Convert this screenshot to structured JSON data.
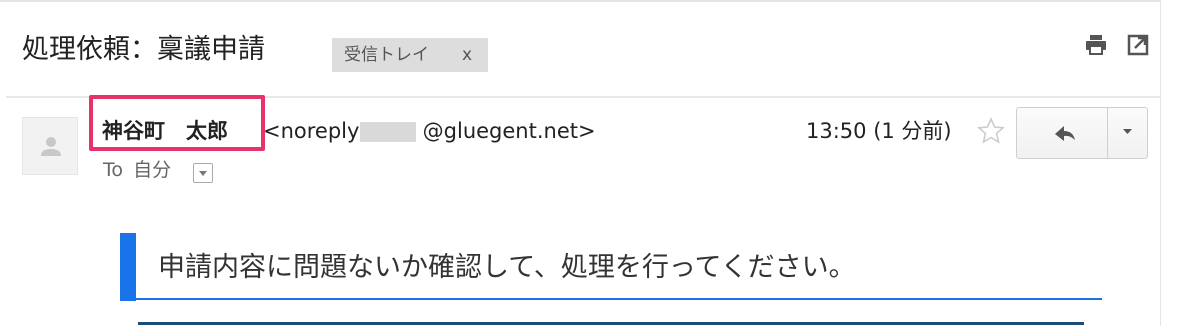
{
  "message": {
    "subject": "処理依頼：稟議申請",
    "label": {
      "name": "受信トレイ",
      "remove": "x"
    },
    "sender": {
      "name": "神谷町　太郎",
      "email_prefix": "<noreply-",
      "email_suffix": "@gluegent.net>"
    },
    "recipient": {
      "to_label": "To",
      "name": "自分"
    },
    "time": "13:50 (1 分前)",
    "body": {
      "notice": "申請内容に問題ないか確認して、処理を行ってください。"
    }
  },
  "icons": {
    "print": "print-icon",
    "new_window": "new-window-icon",
    "star": "star-icon",
    "reply": "reply-icon",
    "more": "chevron-down-icon",
    "avatar": "person-icon"
  },
  "colors": {
    "highlight_box": "#e8336a",
    "accent_blue": "#1a73e8",
    "label_bg": "#dddddd"
  }
}
